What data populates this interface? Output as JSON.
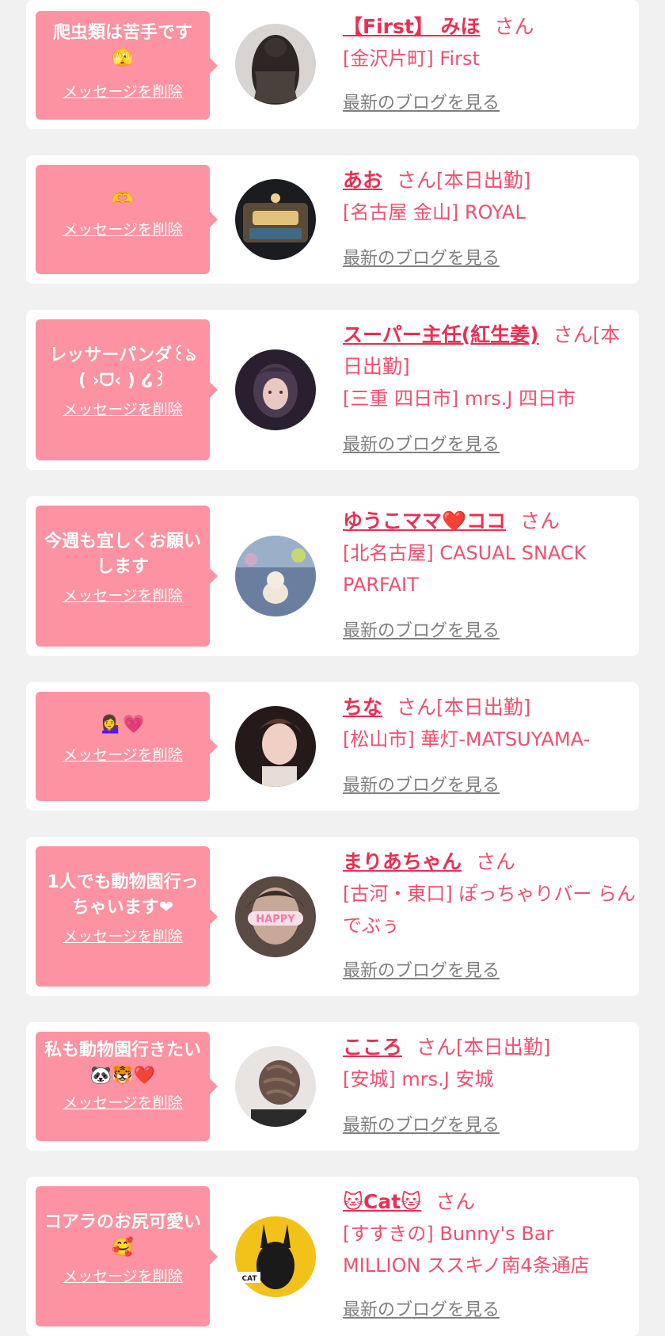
{
  "messages": [
    {
      "bubble_text": "爬虫類は苦手です🫣",
      "delete_label": "メッセージを削除",
      "name": "【First】 みほ",
      "suffix": "さん",
      "shop": "[金沢片町] First",
      "blog_label": "最新のブログを見る",
      "avatar_icon": "photo-long-dark-hair"
    },
    {
      "bubble_text": "🫶",
      "delete_label": "メッセージを削除",
      "name": "あお",
      "suffix": "さん[本日出勤]",
      "shop": "[名古屋 金山] ROYAL",
      "blog_label": "最新のブログを見る",
      "avatar_icon": "photo-ornate-building"
    },
    {
      "bubble_text": "レッサーパンダ꒰ঌ ( ›ᗜ‹ ) ໒꒱",
      "delete_label": "メッセージを削除",
      "name": "スーパー主任(紅生姜)",
      "suffix": "さん[本日出勤]",
      "shop": "[三重 四日市] mrs.J 四日市",
      "blog_label": "最新のブログを見る",
      "avatar_icon": "photo-illustrated-portrait"
    },
    {
      "bubble_text": "今週も宜しくお願いします",
      "delete_label": "メッセージを削除",
      "name": "ゆうこママ❤️ココ",
      "suffix": "さん",
      "shop": "[北名古屋] CASUAL SNACK PARFAIT",
      "blog_label": "最新のブログを見る",
      "avatar_icon": "photo-small-dog"
    },
    {
      "bubble_text": "💁‍♀️💗",
      "delete_label": "メッセージを削除",
      "name": "ちな",
      "suffix": "さん[本日出勤]",
      "shop": "[松山市] 華灯-MATSUYAMA-",
      "blog_label": "最新のブログを見る",
      "avatar_icon": "photo-woman-portrait"
    },
    {
      "bubble_text": "1人でも動物園行っちゃいます❤",
      "delete_label": "メッセージを削除",
      "name": "まりあちゃん",
      "suffix": "さん",
      "shop": "[古河・東口] ぽっちゃりバー らんでぶぅ",
      "blog_label": "最新のブログを見る",
      "avatar_icon": "photo-happy-sticker"
    },
    {
      "bubble_text": "私も動物園行きたい🐼🐯❤️",
      "delete_label": "メッセージを削除",
      "name": "こころ",
      "suffix": "さん[本日出勤]",
      "shop": "[安城] mrs.J 安城",
      "blog_label": "最新のブログを見る",
      "avatar_icon": "photo-braided-hair"
    },
    {
      "bubble_text": "コアラのお尻可愛い🥰",
      "delete_label": "メッセージを削除",
      "name": "🐱Cat🐱",
      "suffix": "さん",
      "shop": "[すすきの] Bunny's Bar MILLION ススキノ南4条通店",
      "blog_label": "最新のブログを見る",
      "avatar_icon": "photo-bunny-cat-poster"
    }
  ],
  "colors": {
    "background": "#f1f1f1",
    "card": "#ffffff",
    "bubble": "#fd93a2",
    "name": "#ea2f53",
    "text_pink": "#f04f6f",
    "link_gray": "#7f7f7f"
  }
}
